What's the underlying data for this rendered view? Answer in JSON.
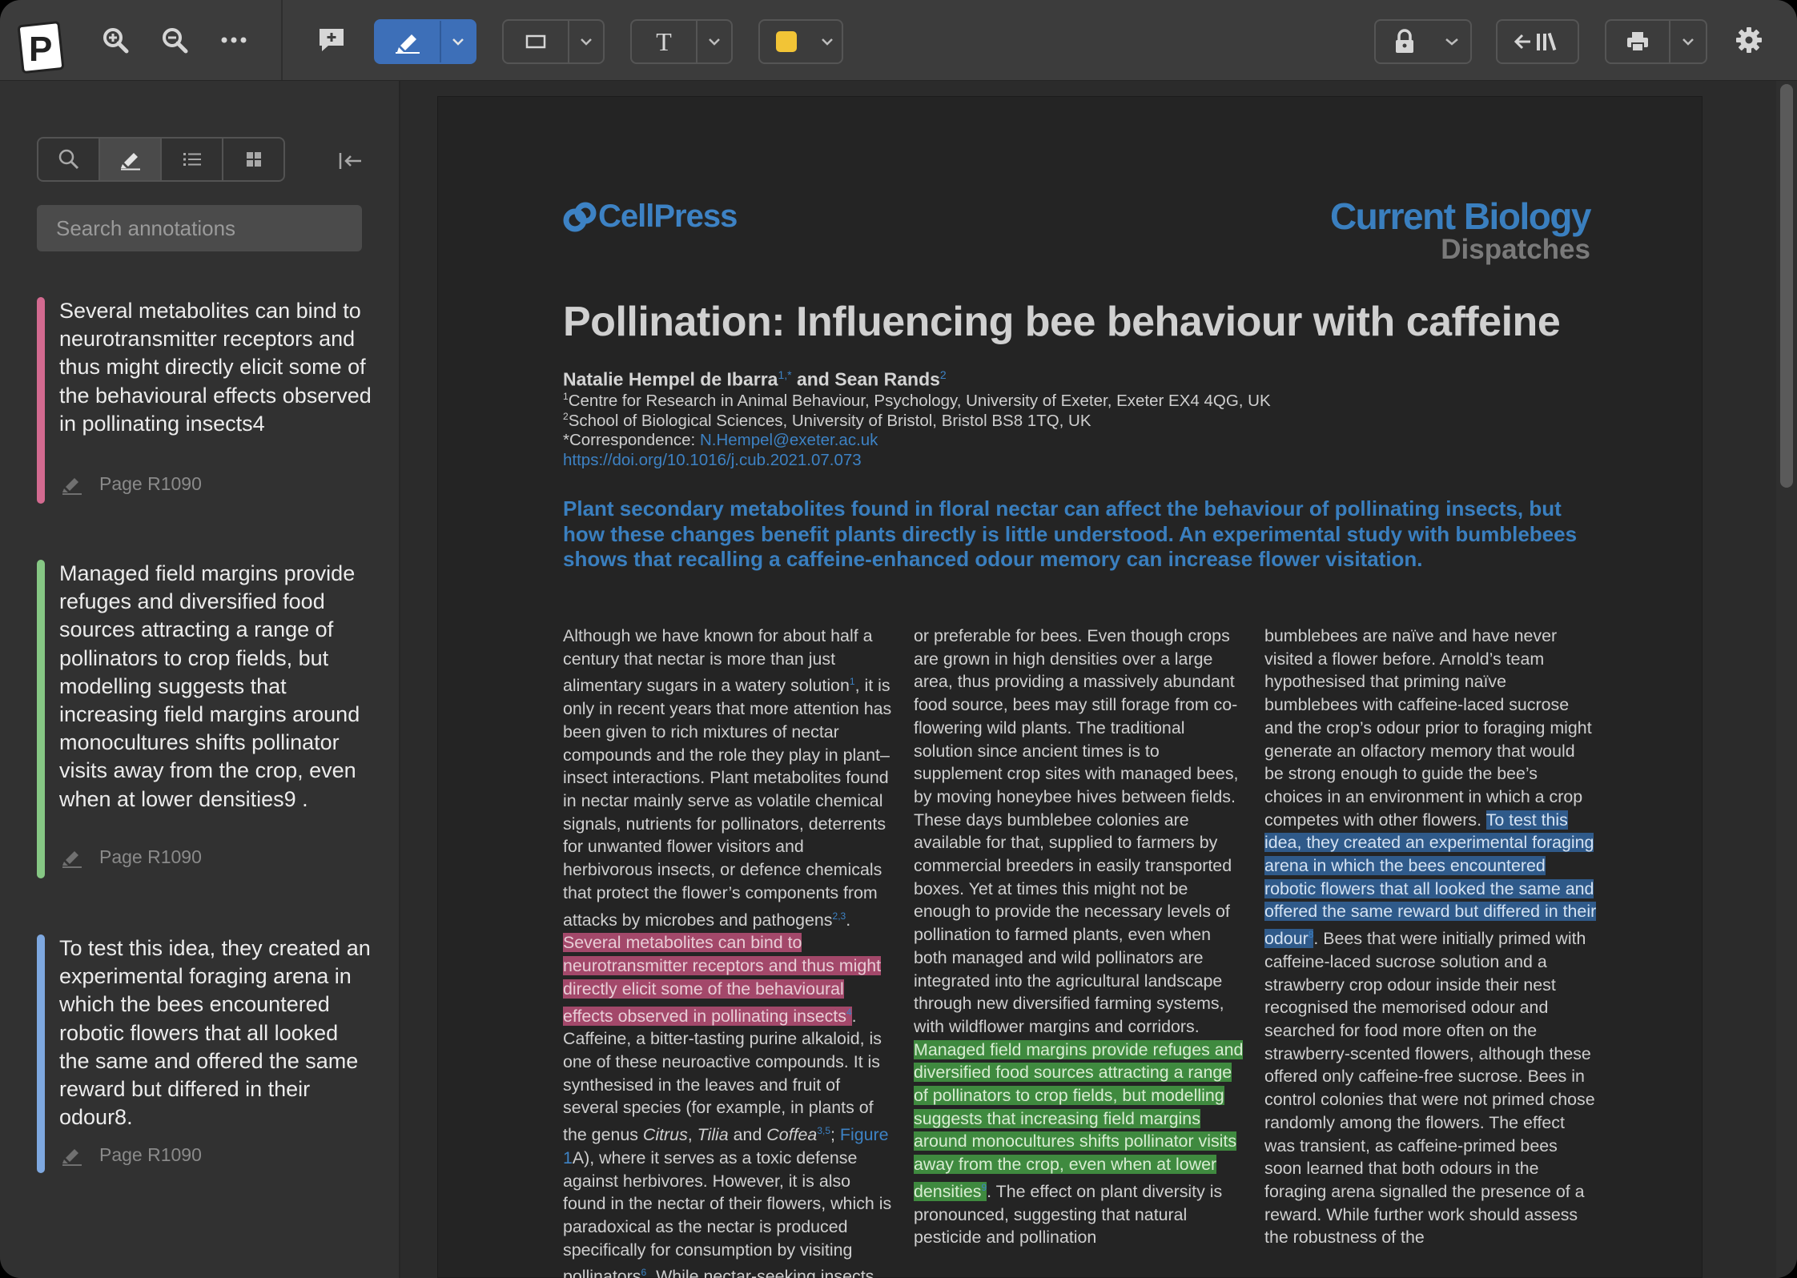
{
  "toolbar": {
    "tools": [
      "zoom-in",
      "zoom-out",
      "more",
      "comment",
      "highlighter",
      "rectangle",
      "text",
      "color",
      "lock",
      "back-to-library",
      "print",
      "settings"
    ],
    "text_tool_glyph": "T",
    "color_swatch": "#f2c436",
    "accent": "#3d6fb8"
  },
  "sidebar": {
    "search_placeholder": "Search annotations",
    "annotations": [
      {
        "text": "Several metabolites can bind to neurotransmitter receptors and thus might directly elicit some of the behavioural effects observed in pollinating insects4",
        "page": "Page R1090",
        "color": "#d36a90"
      },
      {
        "text": "Managed field margins provide refuges and diversified food sources attracting a range of pollinators to crop fields, but modelling suggests that increasing field margins around monocultures shifts pollinator visits away from the crop, even when at lower densities9 .",
        "page": "Page R1090",
        "color": "#86c784"
      },
      {
        "text": "To test this idea, they created an experimental foraging arena in which the bees encountered robotic flowers that all looked the same and offered the same reward but differed in their odour8.",
        "page": "Page R1090",
        "color": "#7ea8e0"
      }
    ]
  },
  "document": {
    "publisher": "CellPress",
    "journal": "Current Biology",
    "section": "Dispatches",
    "title": "Pollination: Influencing bee behaviour with caffeine",
    "authors": {
      "author1": "Natalie Hempel de Ibarra",
      "author1_sup": "1,*",
      "and": " and ",
      "author2": "Sean Rands",
      "author2_sup": "2"
    },
    "affiliations": {
      "aff1_sup": "1",
      "aff1": "Centre for Research in Animal Behaviour, Psychology, University of Exeter, Exeter EX4 4QG, UK",
      "aff2_sup": "2",
      "aff2": "School of Biological Sciences, University of Bristol, Bristol BS8 1TQ, UK",
      "corr_label": "*Correspondence: ",
      "corr_email": "N.Hempel@exeter.ac.uk",
      "doi": "https://doi.org/10.1016/j.cub.2021.07.073"
    },
    "abstract": "Plant secondary metabolites found in floral nectar can affect the behaviour of pollinating insects, but how these changes benefit plants directly is little understood. An experimental study with bumblebees shows that recalling a caffeine-enhanced odour memory can increase flower visitation.",
    "col1": {
      "a": "Although we have known for about half a century that nectar is more than just alimentary sugars in a watery solution",
      "a_sup": "1",
      "b": ", it is only in recent years that more attention has been given to rich mixtures of nectar compounds and the role they play in plant–insect interactions. Plant metabolites found in nectar mainly serve as volatile chemical signals, nutrients for pollinators, deterrents for unwanted flower visitors and herbivorous insects, or defence chemicals that protect the flower’s components from attacks by microbes and pathogens",
      "b_sup": "2,3",
      "c": ". ",
      "hl": "Several metabolites can bind to neurotransmitter receptors and thus might directly elicit some of the behavioural effects observed in pollinating insects",
      "hl_sup": "4",
      "d": ". Caffeine, a bitter-tasting purine alkaloid, is one of these neuroactive compounds. It is synthesised in the leaves and fruit of several species (for example, in plants of the genus ",
      "genus1": "Citrus",
      "comma": ", ",
      "genus2": "Tilia",
      "and": " and ",
      "genus3": "Coffea",
      "e_sup": "3,5",
      "semi": "; ",
      "fig": "Figure 1",
      "f": "A), where it serves as a toxic defense against herbivores. However, it is also found in the nectar of their flowers, which is paradoxical as the nectar is produced specifically for consumption by visiting pollinators",
      "f_sup": "6",
      "g": ". While nectar-seeking insects"
    },
    "col2": {
      "a": "or preferable for bees. Even though crops are grown in high densities over a large area, thus providing a massively abundant food source, bees may still forage from co-flowering wild plants. The traditional solution since ancient times is to supplement crop sites with managed bees, by moving honeybee hives between fields. These days bumblebee colonies are available for that, supplied to farmers by commercial breeders in easily transported boxes. Yet at times this might not be enough to provide the necessary levels of pollination to farmed plants, even when both managed and wild pollinators are integrated into the agricultural landscape through new diversified farming systems, with wildflower margins and corridors. ",
      "hl": "Managed field margins provide refuges and diversified food sources attracting a range of pollinators to crop fields, but modelling suggests that increasing field margins around monocultures shifts pollinator visits away from the crop, even when at lower densities",
      "hl_sup": "9",
      "b": ". The effect on plant diversity is pronounced, suggesting that natural pesticide and pollination"
    },
    "col3": {
      "a": "bumblebees are naïve and have never visited a flower before. Arnold’s team hypothesised that priming naïve bumblebees with caffeine-laced sucrose and the crop’s odour prior to foraging might generate an olfactory memory that would be strong enough to guide the bee’s choices in an environment in which a crop competes with other flowers. ",
      "hl": "To test this idea, they created an experimental foraging arena in which the bees encountered robotic flowers that all looked the same and offered the same reward but differed in their odour",
      "hl_sup": "8",
      "b": ". Bees that were initially primed with caffeine-laced sucrose solution and a strawberry crop odour inside their nest recognised the memorised odour and searched for food more often on the strawberry-scented flowers, although these offered only caffeine-free sucrose. Bees in control colonies that were not primed chose randomly among the flowers. The effect was transient, as caffeine-primed bees soon learned that both odours in the foraging arena signalled the presence of a reward. While further work should assess the robustness of the"
    }
  }
}
